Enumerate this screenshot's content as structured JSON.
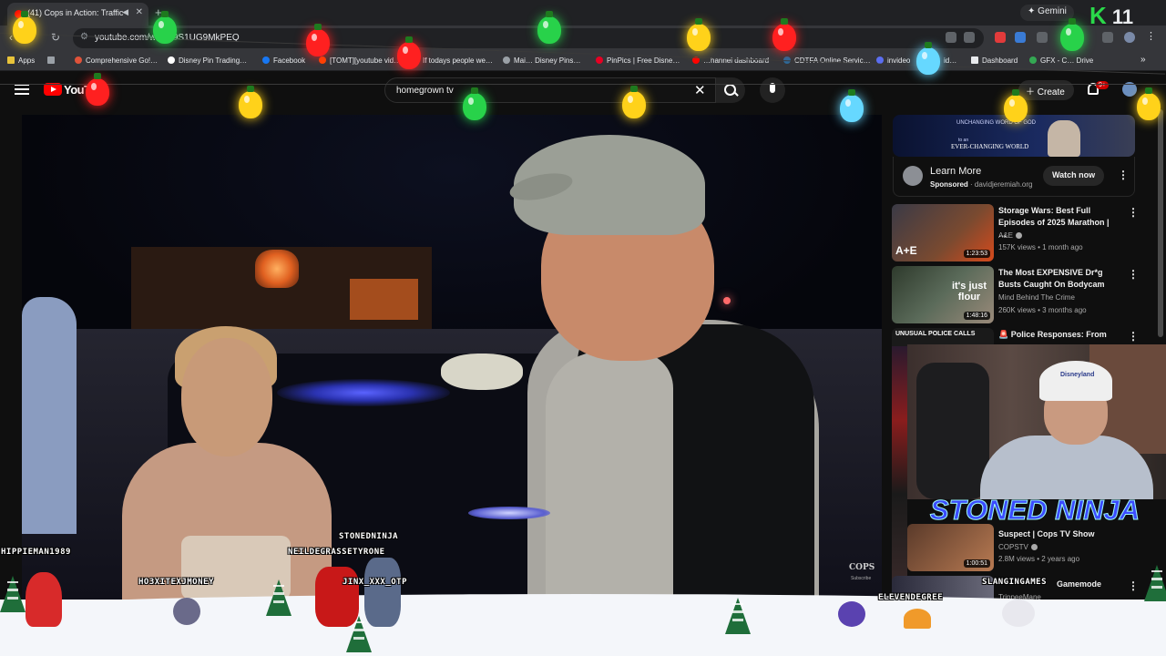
{
  "browser": {
    "tab_title": "(41) Cops in Action: Traffic",
    "new_tab": "+",
    "gemini_label": "Gemini",
    "ext_badge": "K",
    "ext_number": "11",
    "url": "youtube.com/w… =9S1UG9MkPEQ",
    "bookmarks": [
      {
        "label": "Apps"
      },
      {
        "label": "Comprehensive Go!…"
      },
      {
        "label": "Disney Pin Trading…"
      },
      {
        "label": "Facebook"
      },
      {
        "label": "[TOMT][youtube vid…"
      },
      {
        "label": "If todays people we…"
      },
      {
        "label": "Mai… Disney Pins…"
      },
      {
        "label": "PinPics | Free Disne…"
      },
      {
        "label": "…hannel dashboard"
      },
      {
        "label": "CDTFA Online Servic…"
      },
      {
        "label": "invideo"
      },
      {
        "label": "id…"
      },
      {
        "label": "Dashboard"
      },
      {
        "label": "GFX - C… Drive"
      }
    ]
  },
  "youtube": {
    "logo_text": "YouT",
    "search_value": "homegrown tv",
    "create_label": "Create",
    "notifications": "9+"
  },
  "video": {
    "watermark": "COPS",
    "watermark_sub": "Subscribe"
  },
  "sidebar": {
    "ad": {
      "banner_line1": "UNCHANGING WORD OF GOD",
      "banner_line2": "to an",
      "banner_line3": "EVER-CHANGING WORLD",
      "title": "Learn More",
      "sponsored": "Sponsored",
      "domain": "davidjeremiah.org",
      "cta": "Watch now"
    },
    "recommendations": [
      {
        "title": "Storage Wars: Best Full Episodes of 2025 Marathon | …",
        "channel": "A&E",
        "meta": "157K views • 1 month ago",
        "duration": "1:23:53",
        "thumb_text": "A+E"
      },
      {
        "title": "The Most EXPENSIVE Dr*g Busts Caught On Bodycam",
        "channel": "Mind Behind The Crime",
        "meta": "260K views • 3 months ago",
        "duration": "1:48:16",
        "thumb_text": "it's just flour"
      },
      {
        "title": "Police Responses: From",
        "thumb_text": "UNUSUAL POLICE CALLS"
      },
      {
        "title": "Suspect | Cops TV Show",
        "channel": "COPSTV",
        "meta": "2.8M views • 2 years ago",
        "duration": "1:00:51"
      },
      {
        "title": "Gamemode",
        "channel": "TrippeeMane"
      }
    ]
  },
  "stream_overlay": {
    "banner": "STONED NINJA",
    "cap_logo": "Disneyland",
    "chat_names": [
      "HIPPIEMAN1989",
      "STONEDNINJA",
      "NEILDEGRASSETYRONE",
      "HO3XITEXJMONEY",
      "JINX_XXX_OTP",
      "SLANGINGAMES",
      "ELEVENDEGREE"
    ]
  },
  "colors": {
    "yt_red": "#ff0000",
    "ninja_text": "#3b4bff",
    "bulb_colors": [
      "#ffd21a",
      "#28d24a",
      "#ff2020",
      "#66d8ff"
    ]
  }
}
